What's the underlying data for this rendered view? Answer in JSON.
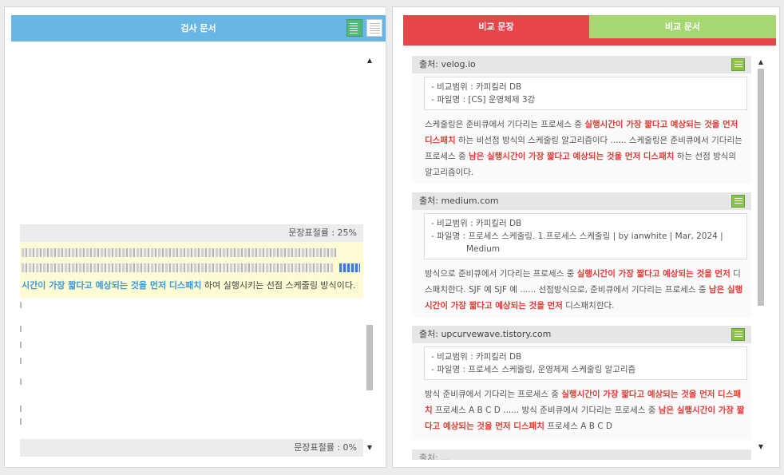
{
  "left_panel": {
    "title": "검사 문서",
    "rate_top": "문장표절률 : 25%",
    "rate_bottom": "문장표절률 : 0%",
    "highlight": {
      "key": "시간이 가장 짧다고 예상되는 것을 먼저 디스패치",
      "rest": " 하여 실행시키는 선점 스케줄링 방식이다."
    }
  },
  "right_panel": {
    "tabs": [
      {
        "label": "비교 문장",
        "active": true,
        "color": "#e84549"
      },
      {
        "label": "비교 문서",
        "active": false,
        "color": "#a6d770"
      }
    ],
    "results": [
      {
        "source": "출처: velog.io",
        "range": "- 비교범위 : 카피킬러 DB",
        "file": "- 파일명 : [CS] 운영체제 3강",
        "file_cont": "",
        "text": [
          {
            "t": "스케줄링은 준비큐에서 기다리는 프로세스 중 ",
            "hit": false
          },
          {
            "t": "실행시간이 가장 짧다고 예상되는 것을 먼저 디스패치",
            "hit": true
          },
          {
            "t": " 하는 비선점 방식의 스케줄링 알고리즘이다 ...... 스케줄링은 준비큐에서 기다리는 프로세스 중 ",
            "hit": false
          },
          {
            "t": "남은 실행시간이 가장 짧다고 예상되는 것을 먼저 디스패치",
            "hit": true
          },
          {
            "t": " 하는 선점 방식의 알고리즘이다.",
            "hit": false
          }
        ]
      },
      {
        "source": "출처: medium.com",
        "range": "- 비교범위 : 카피킬러 DB",
        "file": "- 파일명 : 프로세스 스케줄링. 1.프로세스 스케줄링 | by ianwhite | Mar, 2024 |",
        "file_cont": "Medium",
        "text": [
          {
            "t": "방식으로 준비큐에서 기다리는 프로세스 중 ",
            "hit": false
          },
          {
            "t": "실행시간이 가장 짧다고 예상되는 것을 먼저",
            "hit": true
          },
          {
            "t": " 디스패치한다. SJF 예 SJF 예 ...... 선점방식으로, 준비큐에서 기다리는 프로세스 중 ",
            "hit": false
          },
          {
            "t": "남은 실행시간이 가장 짧다고 예상되는 것을 먼저",
            "hit": true
          },
          {
            "t": " 디스패치한다.",
            "hit": false
          }
        ]
      },
      {
        "source": "출처: upcurvewave.tistory.com",
        "range": "- 비교범위 : 카피킬러 DB",
        "file": "- 파일명 : 프로세스 스케줄링, 운영체제 스케줄링 알고리즘",
        "file_cont": "",
        "text": [
          {
            "t": "방식 준비큐에서 기다리는 프로세스 중 ",
            "hit": false
          },
          {
            "t": "실행시간이 가장 짧다고 예상되는 것을 먼저 디스패치",
            "hit": true
          },
          {
            "t": " 프로세스 A B C D ...... 방식 준비큐에서 기다리는 프로세스 중 ",
            "hit": false
          },
          {
            "t": "남은 실행시간이 가장 짧다고 예상되는 것을 먼저 디스패치",
            "hit": true
          },
          {
            "t": " 프로세스 A B C D",
            "hit": false
          }
        ]
      }
    ],
    "next_source_partial": "출처: ..."
  }
}
